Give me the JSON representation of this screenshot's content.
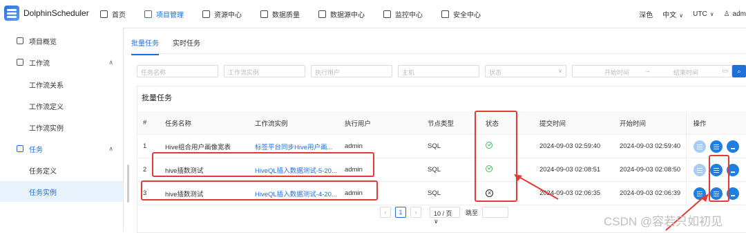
{
  "header": {
    "app_title": "DolphinScheduler",
    "nav": [
      {
        "label": "首页",
        "icon": "home-icon",
        "active": false
      },
      {
        "label": "项目管理",
        "icon": "project-icon",
        "active": true
      },
      {
        "label": "资源中心",
        "icon": "folder-icon",
        "active": false
      },
      {
        "label": "数据质量",
        "icon": "document-icon",
        "active": false
      },
      {
        "label": "数据源中心",
        "icon": "database-icon",
        "active": false
      },
      {
        "label": "监控中心",
        "icon": "monitor-icon",
        "active": false
      },
      {
        "label": "安全中心",
        "icon": "shield-icon",
        "active": false
      }
    ],
    "theme": "深色",
    "language": "中文",
    "timezone": "UTC",
    "user": "adm"
  },
  "sidebar": {
    "items": [
      {
        "label": "项目概览",
        "icon": "overview-icon"
      },
      {
        "label": "工作流",
        "icon": "workflow-icon"
      },
      {
        "label": "工作流关系"
      },
      {
        "label": "工作流定义"
      },
      {
        "label": "工作流实例"
      },
      {
        "label": "任务",
        "icon": "gear-icon"
      },
      {
        "label": "任务定义"
      },
      {
        "label": "任务实例"
      }
    ]
  },
  "tabs": [
    "批量任务",
    "实时任务"
  ],
  "filters": {
    "task_name": "任务名称",
    "workflow_instance": "工作流实例",
    "executor": "执行用户",
    "host": "主机",
    "state": "状态",
    "start_time": "开始时间",
    "end_time": "结束时间"
  },
  "card_title": "批量任务",
  "table": {
    "headers": [
      "#",
      "任务名称",
      "工作流实例",
      "执行用户",
      "节点类型",
      "状态",
      "提交时间",
      "开始时间",
      "操作"
    ],
    "rows": [
      {
        "num": "1",
        "name": "Hive组合用户画像宽表",
        "instance": "标签平台同步Hive用户画...",
        "user": "admin",
        "type": "SQL",
        "state": "success",
        "submit": "2024-09-03 02:59:40",
        "start": "2024-09-03 02:59:40"
      },
      {
        "num": "2",
        "name": "hive插数测试",
        "instance": "HiveQL插入数据测试-5-20...",
        "user": "admin",
        "type": "SQL",
        "state": "success",
        "submit": "2024-09-03 02:08:51",
        "start": "2024-09-03 02:08:50"
      },
      {
        "num": "3",
        "name": "hive插数测试",
        "instance": "HiveQL插入数据测试-4-20...",
        "user": "admin",
        "type": "SQL",
        "state": "failed",
        "submit": "2024-09-03 02:06:35",
        "start": "2024-09-03 02:06:39"
      }
    ]
  },
  "pagination": {
    "current": "1",
    "page_size": "10 / 页",
    "jump_label": "跳至"
  },
  "watermark": "CSDN @容若只如初见",
  "colors": {
    "accent": "#1e6fd9",
    "annotation": "#e53935",
    "success": "#3fbf5f"
  }
}
